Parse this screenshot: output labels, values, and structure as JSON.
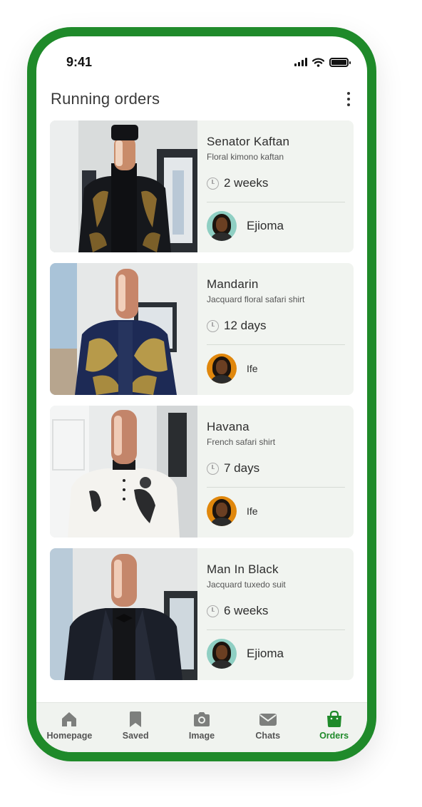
{
  "status_bar": {
    "time": "9:41"
  },
  "header": {
    "title": "Running orders"
  },
  "orders": [
    {
      "name": "Senator Kaftan",
      "description": "Floral kimono kaftan",
      "duration": "2 weeks",
      "tailor": "Ejioma"
    },
    {
      "name": "Mandarin",
      "description": "Jacquard floral safari shirt",
      "duration": "12 days",
      "tailor": "Ife"
    },
    {
      "name": "Havana",
      "description": "French safari shirt",
      "duration": "7 days",
      "tailor": "Ife"
    },
    {
      "name": "Man In Black",
      "description": "Jacquard tuxedo suit",
      "duration": "6 weeks",
      "tailor": "Ejioma"
    }
  ],
  "nav": {
    "items": [
      {
        "label": "Homepage",
        "icon": "home-icon"
      },
      {
        "label": "Saved",
        "icon": "bookmark-icon"
      },
      {
        "label": "Image",
        "icon": "camera-icon"
      },
      {
        "label": "Chats",
        "icon": "envelope-icon"
      },
      {
        "label": "Orders",
        "icon": "shopping-bag-icon"
      }
    ],
    "active": "Orders"
  },
  "colors": {
    "accent": "#1f8a2a",
    "card_bg": "#f1f4f0",
    "nav_bg": "#f0f3ef"
  }
}
